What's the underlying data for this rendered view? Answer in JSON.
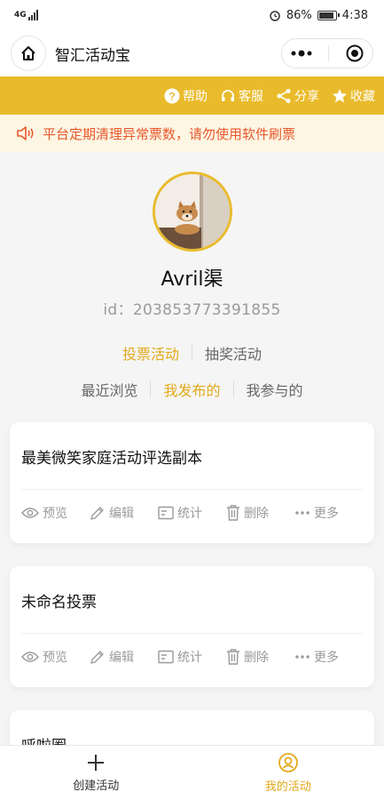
{
  "status_bar": {
    "network": "4G",
    "battery": "86%",
    "time": "4:38"
  },
  "nav": {
    "title": "智汇活动宝"
  },
  "toolbar": [
    {
      "icon": "help-icon",
      "label": "帮助"
    },
    {
      "icon": "headset-icon",
      "label": "客服"
    },
    {
      "icon": "share-icon",
      "label": "分享"
    },
    {
      "icon": "star-icon",
      "label": "收藏"
    }
  ],
  "notice": {
    "text": "平台定期清理异常票数，请勿使用软件刷票"
  },
  "profile": {
    "name": "Avril渠",
    "id_label": "id：",
    "id_value": "203853773391855"
  },
  "activity_tabs": {
    "vote": "投票活动",
    "lottery": "抽奖活动"
  },
  "filter_tabs": {
    "recent": "最近浏览",
    "published": "我发布的",
    "joined": "我参与的"
  },
  "actions": {
    "preview": "预览",
    "edit": "编辑",
    "stats": "统计",
    "delete": "删除",
    "more": "更多"
  },
  "cards": [
    {
      "title": "最美微笑家庭活动评选副本"
    },
    {
      "title": "未命名投票"
    },
    {
      "title": "呼啦圈"
    }
  ],
  "bottom_nav": {
    "create": "创建活动",
    "mine": "我的活动"
  },
  "colors": {
    "accent": "#e9bb2c",
    "notice": "#e8582d"
  }
}
